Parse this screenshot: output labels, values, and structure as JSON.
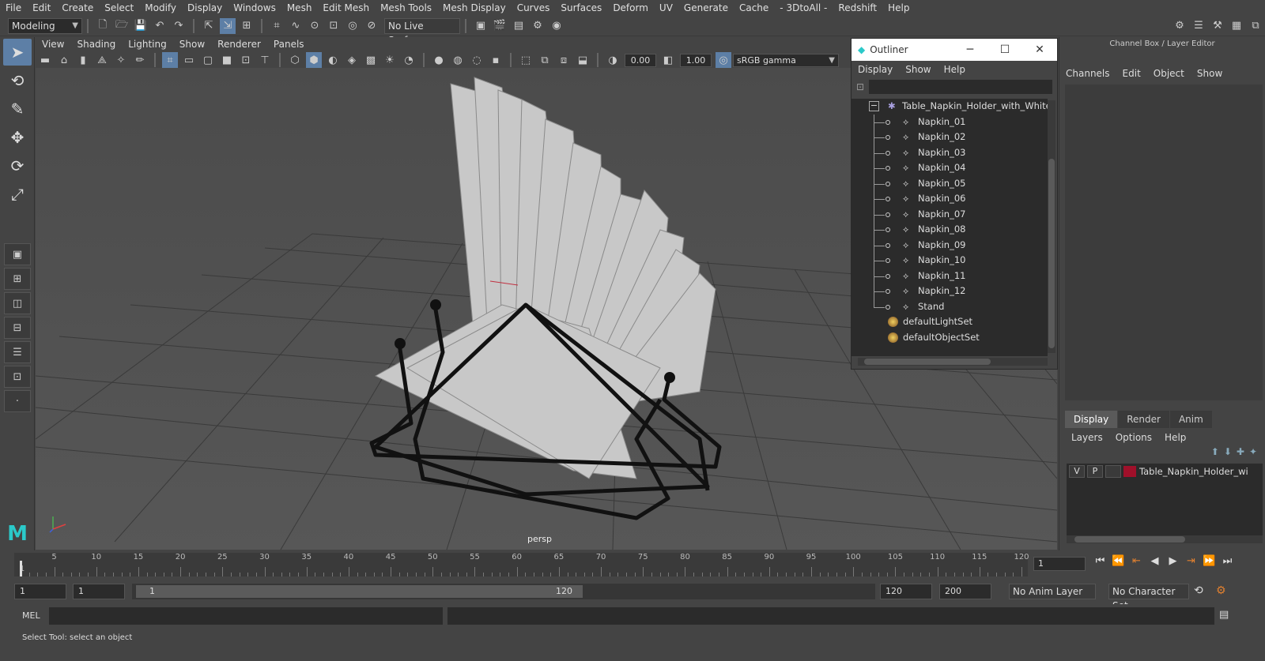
{
  "menubar": [
    "File",
    "Edit",
    "Create",
    "Select",
    "Modify",
    "Display",
    "Windows",
    "Mesh",
    "Edit Mesh",
    "Mesh Tools",
    "Mesh Display",
    "Curves",
    "Surfaces",
    "Deform",
    "UV",
    "Generate",
    "Cache",
    "- 3DtoAll -",
    "Redshift",
    "Help"
  ],
  "toolbar": {
    "mode": "Modeling",
    "live_surface": "No Live Surface"
  },
  "viewport": {
    "menu": [
      "View",
      "Shading",
      "Lighting",
      "Show",
      "Renderer",
      "Panels"
    ],
    "exposure": "0.00",
    "gamma": "1.00",
    "color_space": "sRGB gamma",
    "camera_label": "persp"
  },
  "outliner": {
    "title": "Outliner",
    "menu": [
      "Display",
      "Show",
      "Help"
    ],
    "root": "Table_Napkin_Holder_with_White_N",
    "children": [
      "Napkin_01",
      "Napkin_02",
      "Napkin_03",
      "Napkin_04",
      "Napkin_05",
      "Napkin_06",
      "Napkin_07",
      "Napkin_08",
      "Napkin_09",
      "Napkin_10",
      "Napkin_11",
      "Napkin_12",
      "Stand"
    ],
    "sets": [
      "defaultLightSet",
      "defaultObjectSet"
    ]
  },
  "channel_box": {
    "title": "Channel Box / Layer Editor",
    "menu": [
      "Channels",
      "Edit",
      "Object",
      "Show"
    ],
    "layer_tabs": [
      "Display",
      "Render",
      "Anim"
    ],
    "layer_menu": [
      "Layers",
      "Options",
      "Help"
    ],
    "layer": {
      "v": "V",
      "p": "P",
      "name": "Table_Napkin_Holder_wi",
      "color": "#a0102a"
    }
  },
  "timeline": {
    "ticks": [
      "5",
      "10",
      "15",
      "20",
      "25",
      "30",
      "35",
      "40",
      "45",
      "50",
      "55",
      "60",
      "65",
      "70",
      "75",
      "80",
      "85",
      "90",
      "95",
      "100",
      "105",
      "110",
      "115",
      "120"
    ],
    "start_label": "1",
    "current_frame": "1"
  },
  "range": {
    "start": "1",
    "playback_start": "1",
    "slider_start": "1",
    "slider_end": "120",
    "playback_end": "120",
    "end": "200",
    "anim_layer": "No Anim Layer",
    "character_set": "No Character Set"
  },
  "command": {
    "label": "MEL"
  },
  "help_line": "Select Tool: select an object"
}
